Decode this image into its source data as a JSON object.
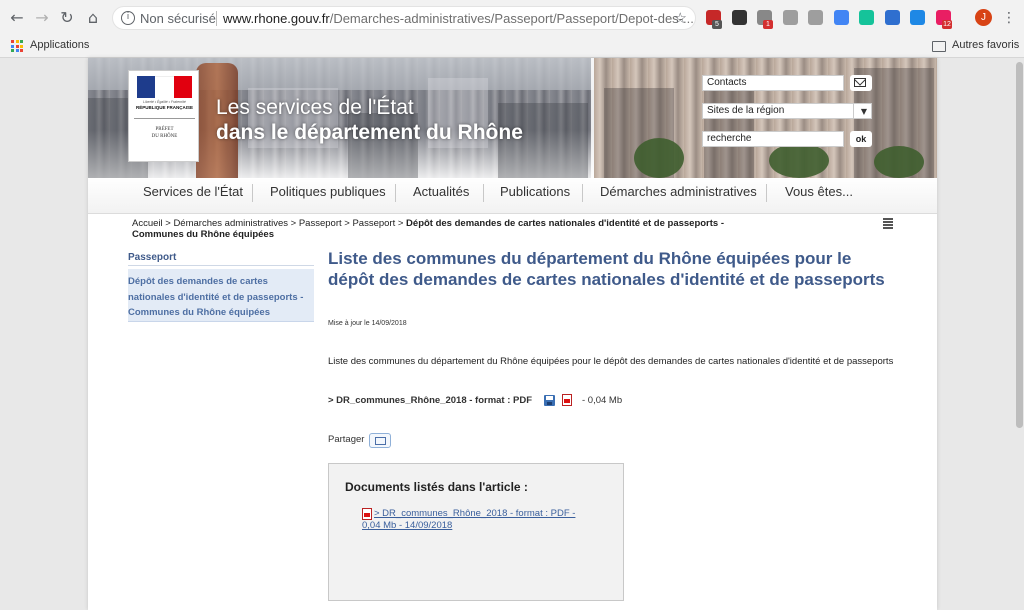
{
  "browser": {
    "security_label": "Non sécurisé",
    "url_domain": "www.rhone.gouv.fr",
    "url_path": "/Demarches-administratives/Passeport/Passeport/Depot-des-...",
    "extensions": [
      {
        "name": "adblock-icon",
        "badge": "5",
        "color": "#c62828"
      },
      {
        "name": "pocket-icon",
        "badge": "",
        "color": "#333333"
      },
      {
        "name": "tools-icon",
        "badge": "1",
        "color": "#888888"
      },
      {
        "name": "document-icon",
        "badge": "",
        "color": "#9e9e9e"
      },
      {
        "name": "cloud-icon",
        "badge": "",
        "color": "#9e9e9e"
      },
      {
        "name": "translate-icon",
        "badge": "",
        "color": "#4285f4"
      },
      {
        "name": "grammarly-icon",
        "badge": "",
        "color": "#15c39a"
      },
      {
        "name": "compass-icon",
        "badge": "",
        "color": "#2f6fcf"
      },
      {
        "name": "pen-icon",
        "badge": "",
        "color": "#1e88e5"
      },
      {
        "name": "translator-icon",
        "badge": "12",
        "color": "#e91e63"
      }
    ],
    "profile_initial": "J",
    "bookmarks": {
      "apps": "Applications",
      "others": "Autres favoris"
    }
  },
  "header": {
    "title_line1": "Les services de l'État",
    "title_line2": "dans le département du Rhône",
    "logo": {
      "motto": "Liberté • Égalité • Fraternité",
      "republique": "RÉPUBLIQUE FRANÇAISE",
      "prefet_line1": "PRÉFET",
      "prefet_line2": "DU RHÔNE"
    },
    "contacts_label": "Contacts",
    "sites_label": "Sites de la région",
    "search_value": "recherche",
    "search_button": "ok"
  },
  "menu": {
    "items": [
      "Services de l'État",
      "Politiques publiques",
      "Actualités",
      "Publications",
      "Démarches administratives",
      "Vous êtes..."
    ]
  },
  "breadcrumb": {
    "path": "Accueil > Démarches administratives > Passeport > Passeport > ",
    "current": "Dépôt des demandes de cartes nationales d'identité et de passeports - Communes du Rhône équipées"
  },
  "sidebar": {
    "title": "Passeport",
    "item": "Dépôt des demandes de cartes nationales d'identité et de passeports - Communes du Rhône équipées"
  },
  "article": {
    "title": "Liste des communes du département du Rhône équipées pour le dépôt des demandes de cartes nationales d'identité et de passeports",
    "updated": "Mise à jour le 14/09/2018",
    "paragraph": "Liste des communes du département du Rhône équipées pour le dépôt des demandes de cartes nationales d'identité et de passeports",
    "download_label": "> DR_communes_Rhône_2018 - format : PDF",
    "download_size": "- 0,04 Mb",
    "share_label": "Partager",
    "docs_title": "Documents listés dans l'article :",
    "doc_link": "> DR_communes_Rhône_2018 - format : PDF - 0,04 Mb - 14/09/2018"
  }
}
